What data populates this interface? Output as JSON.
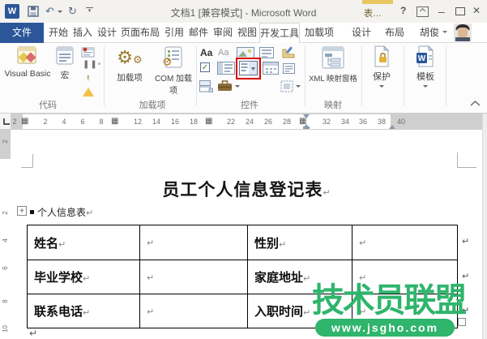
{
  "window": {
    "title": "文档1 [兼容模式] - Microsoft Word",
    "contextual_hint": "表…",
    "help": "?",
    "minimize": "–",
    "close": "✕",
    "logo": "W"
  },
  "quick_access": {
    "undo": "↶",
    "redo": "↻"
  },
  "tabs": {
    "file": "文件",
    "items": [
      "开始",
      "插入",
      "设计",
      "页面布局",
      "引用",
      "邮件",
      "审阅",
      "视图",
      "开发工具",
      "加载项"
    ],
    "active": "开发工具",
    "contextual": [
      "设计",
      "布局"
    ],
    "user": "胡俊"
  },
  "ribbon": {
    "group_labels": {
      "code": "代码",
      "addins": "加载项",
      "controls": "控件",
      "mapping": "映射"
    },
    "buttons": {
      "visual_basic": "Visual Basic",
      "macros": "宏",
      "addins": "加载项",
      "com_addins": "COM 加载项",
      "xml_pane": "XML 映射窗格",
      "protect": "保护",
      "templates": "模板"
    },
    "control_glyphs": {
      "rich_text": "Aa",
      "plain_text": "Aa",
      "checkbox": "✓"
    },
    "gear": "⚙",
    "collapse": "collapse-ribbon"
  },
  "ruler": {
    "h": [
      "2",
      "2",
      "4",
      "6",
      "8",
      "12",
      "14",
      "16",
      "18",
      "22",
      "24",
      "26",
      "28",
      "32",
      "34",
      "36",
      "38",
      "40"
    ],
    "v": [
      "2",
      "2",
      "4",
      "6",
      "8",
      "10"
    ],
    "marker": "▦"
  },
  "document": {
    "title": "员工个人信息登记表",
    "caption": "个人信息表",
    "pilcrow": "↵",
    "handle": "+",
    "table": {
      "rows": [
        [
          "姓名",
          "",
          "性别",
          ""
        ],
        [
          "毕业学校",
          "",
          "家庭地址",
          ""
        ],
        [
          "联系电话",
          "",
          "入职时间",
          ""
        ]
      ]
    }
  },
  "watermark": {
    "brand": "技术员联盟",
    "url": "www.jsgho.com",
    "green": "#2fb56c"
  },
  "colors": {
    "accent_blue": "#2b579a",
    "highlight_red": "#dd0000",
    "contextual_yellow": "#e9c65f"
  }
}
